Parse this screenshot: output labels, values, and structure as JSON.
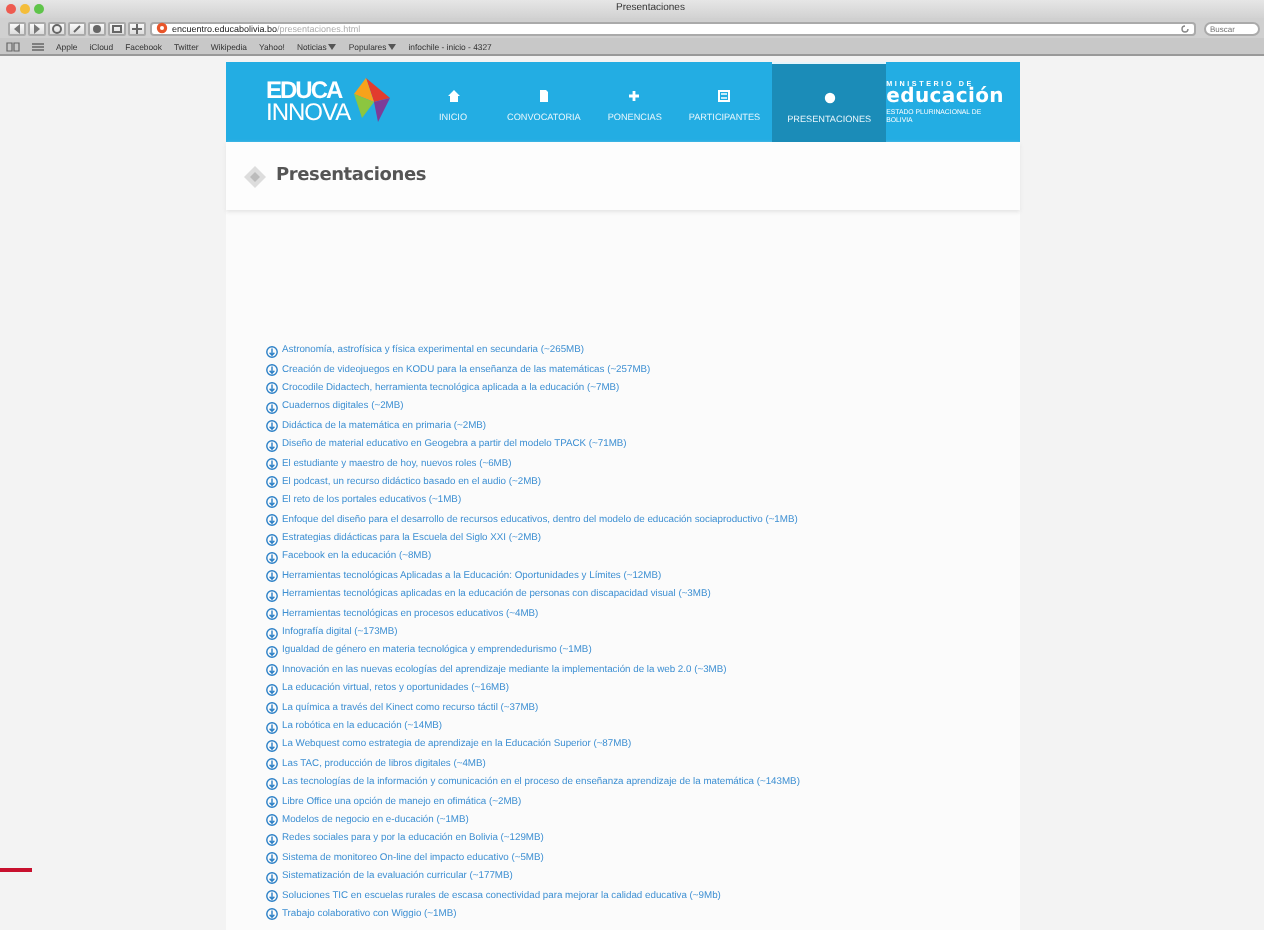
{
  "browser": {
    "title": "Presentaciones",
    "url_host": "encuentro.educabolivia.bo",
    "url_path": "/presentaciones.html",
    "search_placeholder": "Buscar",
    "bookmarks": [
      {
        "label": "Apple",
        "menu": false
      },
      {
        "label": "iCloud",
        "menu": false
      },
      {
        "label": "Facebook",
        "menu": false
      },
      {
        "label": "Twitter",
        "menu": false
      },
      {
        "label": "Wikipedia",
        "menu": false
      },
      {
        "label": "Yahoo!",
        "menu": false
      },
      {
        "label": "Noticias",
        "menu": true
      },
      {
        "label": "Populares",
        "menu": true
      },
      {
        "label": "infochile - inicio - 4327",
        "menu": false
      }
    ]
  },
  "site": {
    "logo": {
      "top": "EDUCA",
      "bottom": "INNOVA"
    },
    "nav": [
      {
        "label": "INICIO",
        "selected": false
      },
      {
        "label": "CONVOCATORIA",
        "selected": false
      },
      {
        "label": "PONENCIAS",
        "selected": false
      },
      {
        "label": "PARTICIPANTES",
        "selected": false
      },
      {
        "label": "PRESENTACIONES",
        "selected": true
      }
    ],
    "ministry": {
      "top": "MINISTERIO DE",
      "name": "educación",
      "sub": "ESTADO PLURINACIONAL DE BOLIVIA"
    }
  },
  "heading": "Presentaciones",
  "presentations": [
    "Astronomía, astrofísica y física experimental en secundaria (~265MB)",
    "Creación de videojuegos en KODU para la enseñanza de las matemáticas (~257MB)",
    "Crocodile Didactech, herramienta tecnológica aplicada a la educación (~7MB)",
    "Cuadernos digitales (~2MB)",
    "Didáctica de la matemática en primaria (~2MB)",
    "Diseño de material educativo en Geogebra a partir del modelo TPACK (~71MB)",
    "El estudiante y maestro de hoy, nuevos roles (~6MB)",
    "El podcast, un recurso didáctico basado en el audio (~2MB)",
    "El reto de los portales educativos (~1MB)",
    "Enfoque del diseño para el desarrollo de recursos educativos, dentro del modelo de educación sociaproductivo (~1MB)",
    "Estrategias didácticas para la Escuela del Siglo XXI (~2MB)",
    "Facebook en la educación (~8MB)",
    "Herramientas tecnológicas Aplicadas a la Educación: Oportunidades y Límites (~12MB)",
    "Herramientas tecnológicas aplicadas en la educación de personas con discapacidad visual (~3MB)",
    "Herramientas tecnológicas en procesos educativos (~4MB)",
    "Infografía digital (~173MB)",
    "Igualdad de género en materia tecnológica y emprendedurismo (~1MB)",
    "Innovación en las nuevas ecologías del aprendizaje mediante la implementación de la web 2.0 (~3MB)",
    "La educación virtual, retos y oportunidades (~16MB)",
    "La química a través del Kinect como recurso táctil (~37MB)",
    "La robótica en la educación (~14MB)",
    "La Webquest como estrategia de aprendizaje en la Educación Superior (~87MB)",
    "Las TAC, producción de libros digitales (~4MB)",
    "Las tecnologías de la información y comunicación en el proceso de enseñanza aprendizaje de la matemática (~143MB)",
    "Libre Office una opción de manejo en ofimática (~2MB)",
    "Modelos de negocio en e-ducación (~1MB)",
    "Redes sociales para y por la educación en Bolivia (~129MB)",
    "Sistema de monitoreo On-line del impacto educativo (~5MB)",
    "Sistematización de la evaluación curricular (~177MB)",
    "Soluciones TIC en escuelas rurales de escasa conectividad para mejorar la calidad educativa (~9Mb)",
    "Trabajo colaborativo con Wiggio (~1MB)"
  ]
}
